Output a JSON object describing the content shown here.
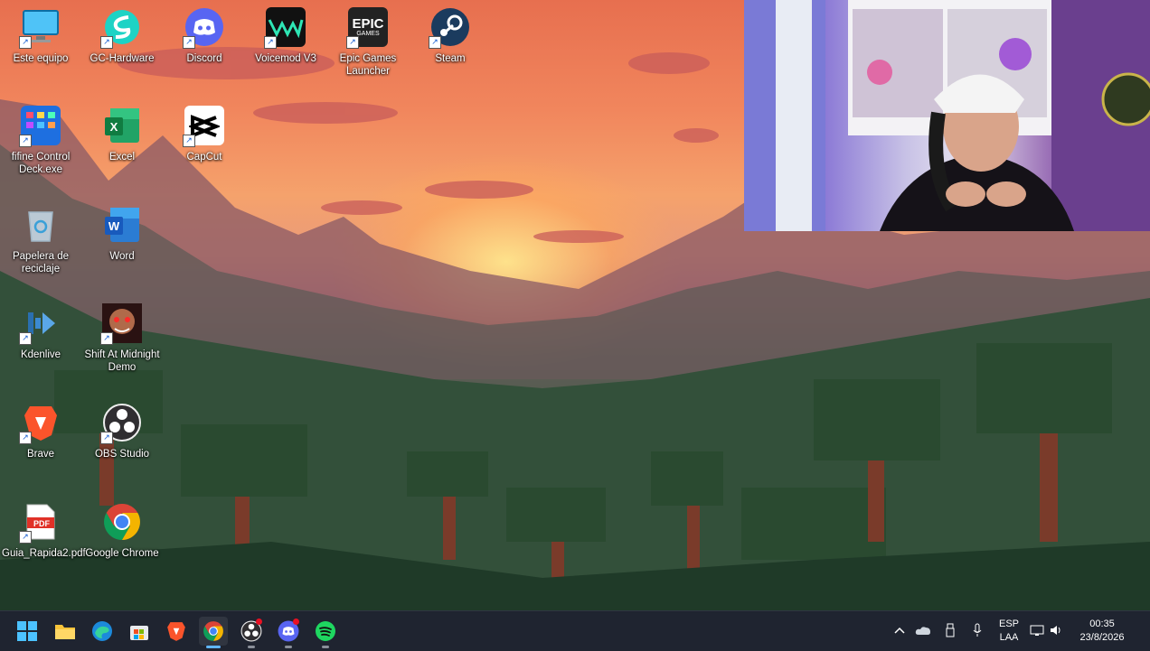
{
  "desktop": {
    "icons": [
      {
        "label": "Este equipo",
        "icon": "computer-icon"
      },
      {
        "label": "GC-Hardware",
        "icon": "gc-hardware-icon"
      },
      {
        "label": "Discord",
        "icon": "discord-icon"
      },
      {
        "label": "Voicemod V3",
        "icon": "voicemod-icon"
      },
      {
        "label": "Epic Games Launcher",
        "icon": "epic-games-icon"
      },
      {
        "label": "Steam",
        "icon": "steam-icon"
      },
      {
        "label": "fifine Control Deck.exe",
        "icon": "fifine-icon"
      },
      {
        "label": "Excel",
        "icon": "excel-icon"
      },
      {
        "label": "CapCut",
        "icon": "capcut-icon"
      },
      {
        "label": "Papelera de reciclaje",
        "icon": "recycle-bin-icon"
      },
      {
        "label": "Word",
        "icon": "word-icon"
      },
      {
        "label": "Kdenlive",
        "icon": "kdenlive-icon"
      },
      {
        "label": "Shift At Midnight Demo",
        "icon": "shift-at-midnight-icon"
      },
      {
        "label": "Brave",
        "icon": "brave-icon"
      },
      {
        "label": "OBS Studio",
        "icon": "obs-icon"
      },
      {
        "label": "Guia_Rapida2.pdf",
        "icon": "pdf-icon"
      },
      {
        "label": "Google Chrome",
        "icon": "chrome-icon"
      }
    ],
    "epic_logo_text": "EPIC",
    "epic_logo_sub": "GAMES",
    "pdf_badge": "PDF"
  },
  "taskbar": {
    "apps": [
      {
        "name": "start",
        "icon": "windows-start-icon"
      },
      {
        "name": "file-explorer",
        "icon": "folder-icon"
      },
      {
        "name": "edge",
        "icon": "edge-icon"
      },
      {
        "name": "store",
        "icon": "store-icon"
      },
      {
        "name": "brave",
        "icon": "brave-icon"
      },
      {
        "name": "chrome",
        "icon": "chrome-icon"
      },
      {
        "name": "obs",
        "icon": "obs-icon"
      },
      {
        "name": "discord",
        "icon": "discord-icon"
      },
      {
        "name": "spotify",
        "icon": "spotify-icon"
      }
    ],
    "tray": {
      "language_top": "ESP",
      "language_bottom": "LAA",
      "time": "00:35",
      "date": "23/8/2026"
    }
  },
  "colors": {
    "taskbar_bg": "#1f2430",
    "active_indicator": "#60b6ff"
  }
}
